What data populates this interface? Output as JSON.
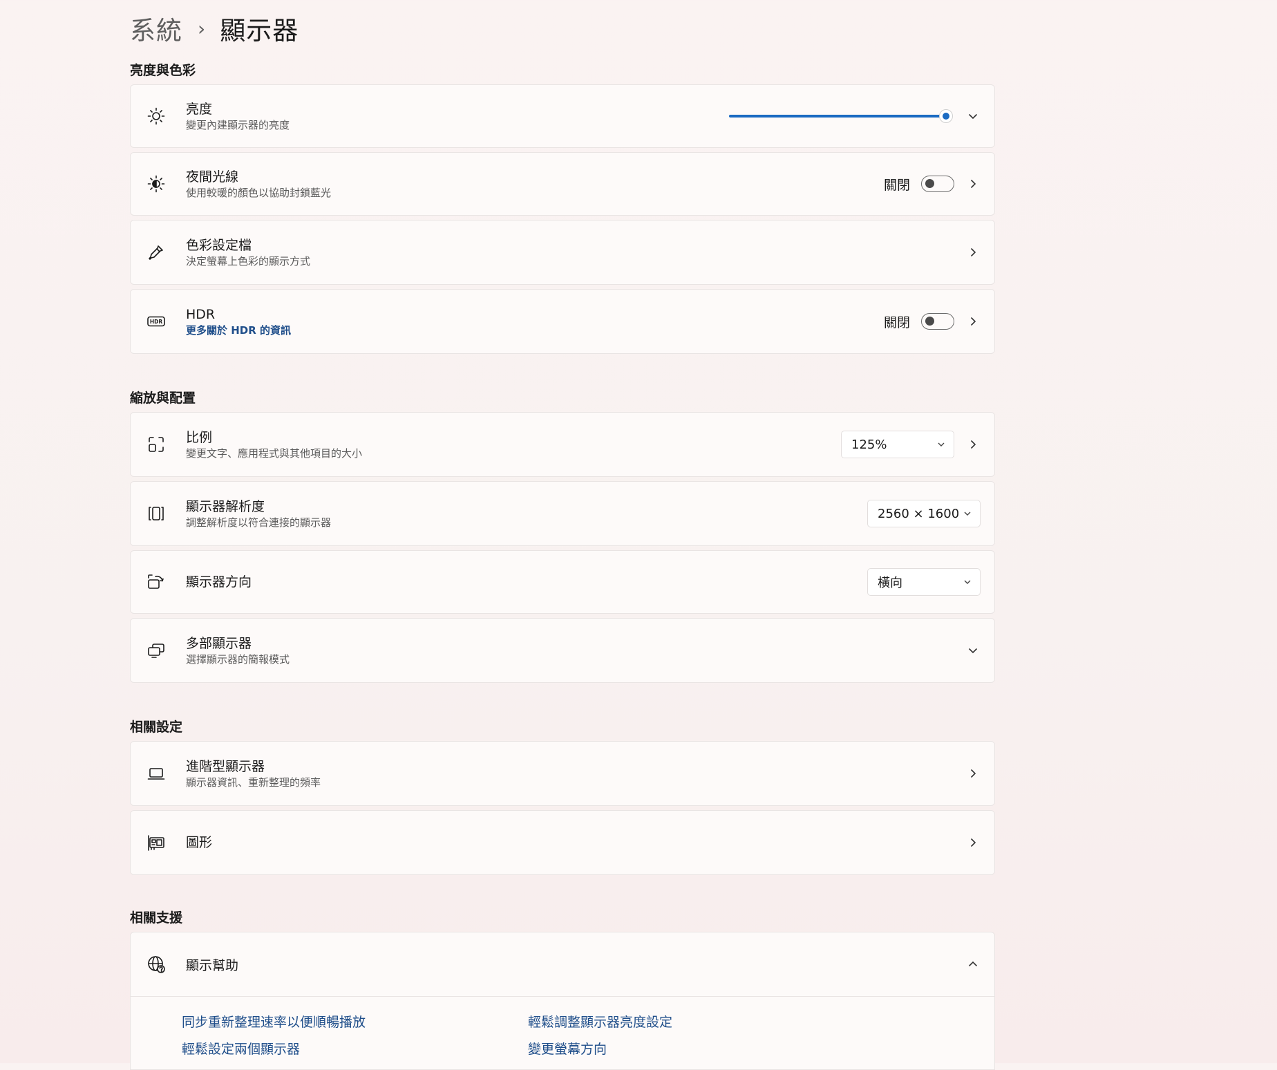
{
  "breadcrumb": {
    "parent": "系統",
    "separator": "›",
    "current": "顯示器"
  },
  "sections": {
    "brightness_color": {
      "title": "亮度與色彩",
      "brightness": {
        "title": "亮度",
        "subtitle": "變更內建顯示器的亮度",
        "value_percent": 100
      },
      "night_light": {
        "title": "夜間光線",
        "subtitle": "使用較暖的顏色以協助封鎖藍光",
        "state": "關閉"
      },
      "color_profile": {
        "title": "色彩設定檔",
        "subtitle": "決定螢幕上色彩的顯示方式"
      },
      "hdr": {
        "title": "HDR",
        "subtitle": "更多關於 HDR 的資訊",
        "state": "關閉"
      }
    },
    "scale_layout": {
      "title": "縮放與配置",
      "scale": {
        "title": "比例",
        "subtitle": "變更文字、應用程式與其他項目的大小",
        "value": "125%"
      },
      "resolution": {
        "title": "顯示器解析度",
        "subtitle": "調整解析度以符合連接的顯示器",
        "value": "2560 × 1600"
      },
      "orientation": {
        "title": "顯示器方向",
        "value": "橫向"
      },
      "multiple_displays": {
        "title": "多部顯示器",
        "subtitle": "選擇顯示器的簡報模式"
      }
    },
    "related_settings": {
      "title": "相關設定",
      "advanced_display": {
        "title": "進階型顯示器",
        "subtitle": "顯示器資訊、重新整理的頻率"
      },
      "graphics": {
        "title": "圖形"
      }
    },
    "related_support": {
      "title": "相關支援",
      "display_help": {
        "title": "顯示幫助",
        "links": [
          "同步重新整理速率以便順暢播放",
          "輕鬆調整顯示器亮度設定",
          "輕鬆設定兩個顯示器",
          "變更螢幕方向"
        ]
      }
    }
  },
  "colors": {
    "accent": "#1a6ac2",
    "link": "#1f4e8a"
  }
}
